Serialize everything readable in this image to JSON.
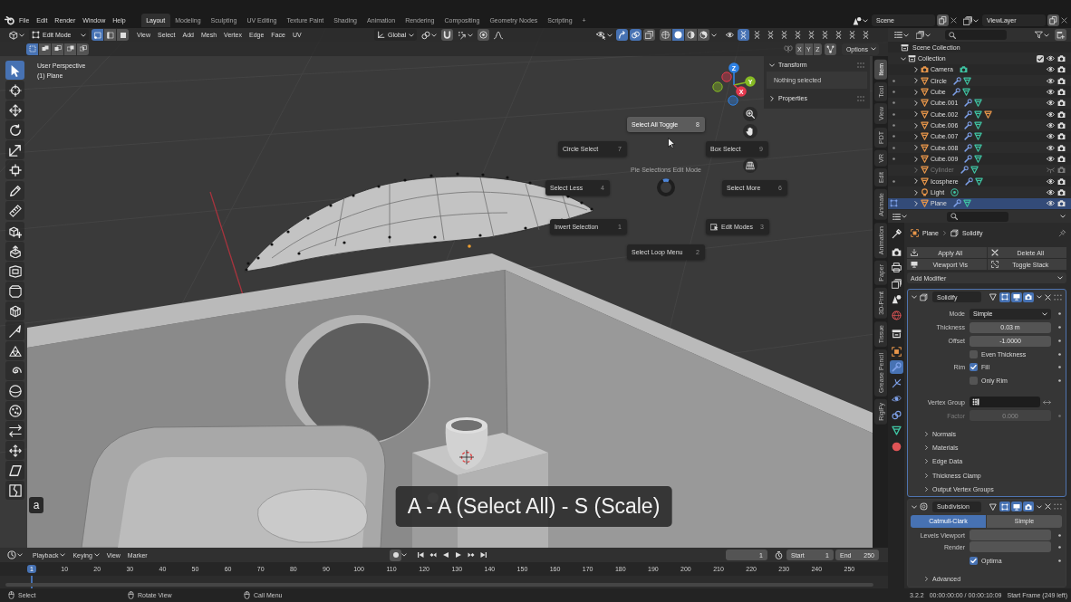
{
  "topbar": {
    "menus": [
      "File",
      "Edit",
      "Render",
      "Window",
      "Help"
    ],
    "workspaces": [
      {
        "label": "Layout",
        "selected": true
      },
      {
        "label": "Modeling",
        "selected": false
      },
      {
        "label": "Sculpting",
        "selected": false
      },
      {
        "label": "UV Editing",
        "selected": false
      },
      {
        "label": "Texture Paint",
        "selected": false
      },
      {
        "label": "Shading",
        "selected": false
      },
      {
        "label": "Animation",
        "selected": false
      },
      {
        "label": "Rendering",
        "selected": false
      },
      {
        "label": "Compositing",
        "selected": false
      },
      {
        "label": "Geometry Nodes",
        "selected": false
      },
      {
        "label": "Scripting",
        "selected": false
      }
    ],
    "add_workspace": "+",
    "scene": "Scene",
    "view_layer": "ViewLayer"
  },
  "viewport": {
    "header": {
      "mode": "Edit Mode",
      "select_modes": [
        {
          "kind": "vertex",
          "selected": true
        },
        {
          "kind": "edge",
          "selected": false
        },
        {
          "kind": "face",
          "selected": false
        }
      ],
      "menus": [
        "View",
        "Select",
        "Add",
        "Mesh",
        "Vertex",
        "Edge",
        "Face",
        "UV"
      ],
      "orientation": "Global",
      "toggles": [
        {
          "kind": "gizmos",
          "on": true
        },
        {
          "kind": "overlays",
          "on": true
        },
        {
          "kind": "xray",
          "on": false
        }
      ],
      "shading": [
        {
          "kind": "wireframe",
          "selected": false
        },
        {
          "kind": "solid",
          "selected": true
        },
        {
          "kind": "material",
          "selected": false
        },
        {
          "kind": "rendered",
          "selected": false
        }
      ],
      "filters": [
        {
          "kind": "eye",
          "selected": false
        },
        {
          "kind": "helix",
          "selected": true
        },
        {
          "kind": "helix",
          "selected": false
        },
        {
          "kind": "helix",
          "selected": false
        },
        {
          "kind": "helix",
          "selected": false
        },
        {
          "kind": "helix",
          "selected": false
        },
        {
          "kind": "helix",
          "selected": false
        },
        {
          "kind": "helix",
          "selected": false
        },
        {
          "kind": "helix",
          "selected": false
        },
        {
          "kind": "helix",
          "selected": false
        },
        {
          "kind": "helix",
          "selected": false
        }
      ]
    },
    "subheader": {
      "box_modes": [
        {
          "kind": "new",
          "selected": true
        },
        {
          "kind": "extend",
          "selected": false
        },
        {
          "kind": "subtract",
          "selected": false
        },
        {
          "kind": "invert",
          "selected": false
        },
        {
          "kind": "intersect",
          "selected": false
        }
      ],
      "mirror_axes": [
        {
          "label": "X",
          "on": false
        },
        {
          "label": "Y",
          "on": false
        },
        {
          "label": "Z",
          "on": false
        }
      ],
      "options": "Options"
    },
    "tool_groups": [
      [
        {
          "kind": "select",
          "selected": true
        },
        {
          "kind": "cursor",
          "selected": false
        },
        {
          "kind": "move",
          "selected": false
        },
        {
          "kind": "rotate",
          "selected": false
        },
        {
          "kind": "scale",
          "selected": false
        },
        {
          "kind": "transform",
          "selected": false
        }
      ],
      [
        {
          "kind": "annotate",
          "selected": false
        },
        {
          "kind": "measure",
          "selected": false
        }
      ],
      [
        {
          "kind": "add_cube",
          "selected": false
        },
        {
          "kind": "extrude",
          "selected": false
        },
        {
          "kind": "inset",
          "selected": false
        },
        {
          "kind": "bevel",
          "selected": false
        },
        {
          "kind": "loop_cut",
          "selected": false
        },
        {
          "kind": "knife",
          "selected": false
        },
        {
          "kind": "poly_build",
          "selected": false
        },
        {
          "kind": "spin",
          "selected": false
        },
        {
          "kind": "smooth",
          "selected": false
        },
        {
          "kind": "randomize",
          "selected": false
        },
        {
          "kind": "edge_slide",
          "selected": false
        },
        {
          "kind": "shrink_fatten",
          "selected": false
        },
        {
          "kind": "shear",
          "selected": false
        },
        {
          "kind": "rip",
          "selected": false
        }
      ]
    ],
    "view_name": "User Perspective",
    "object_label": "(1) Plane",
    "gizmo_axes": [
      {
        "label": "Z",
        "color": "#2f82e4"
      },
      {
        "label": "Y",
        "color": "#86ba24"
      },
      {
        "label": "X",
        "color": "#e5384e"
      }
    ],
    "sidebar": {
      "panels": [
        {
          "title": "Transform",
          "expanded": true,
          "text": "Nothing selected"
        },
        {
          "title": "Properties",
          "expanded": false
        }
      ],
      "tabs": [
        {
          "label": "Item",
          "selected": true
        },
        {
          "label": "Tool",
          "selected": false
        },
        {
          "label": "View",
          "selected": false
        },
        {
          "label": "PDT",
          "selected": false
        },
        {
          "label": "VR",
          "selected": false
        },
        {
          "label": "Edit",
          "selected": false
        },
        {
          "label": "Animate",
          "selected": false
        },
        {
          "label": "Animation",
          "selected": false
        },
        {
          "label": "Paper",
          "selected": false
        },
        {
          "label": "3D-Print",
          "selected": false
        },
        {
          "label": "Tissue",
          "selected": false
        },
        {
          "label": "Grease Pencil",
          "selected": false
        },
        {
          "label": "RigiFy",
          "selected": false
        }
      ]
    },
    "pie_menu": {
      "title": "Pie Selections Edit Mode",
      "items": [
        {
          "label": "Select All Toggle",
          "key": "8",
          "selected": true,
          "with_icon": false
        },
        {
          "label": "Circle Select",
          "key": "7",
          "selected": false,
          "with_icon": false
        },
        {
          "label": "Box Select",
          "key": "9",
          "selected": false,
          "with_icon": false
        },
        {
          "label": "Select Less",
          "key": "4",
          "selected": false,
          "with_icon": false
        },
        {
          "label": "Select More",
          "key": "6",
          "selected": false,
          "with_icon": false
        },
        {
          "label": "Invert Selection",
          "key": "1",
          "selected": false,
          "with_icon": false
        },
        {
          "label": "Edit Modes",
          "key": "3",
          "selected": false,
          "with_icon": true
        },
        {
          "label": "Select Loop Menu",
          "key": "2",
          "selected": false,
          "with_icon": false
        }
      ]
    },
    "key_overlay": "a",
    "caption": "A - A (Select All) - S (Scale)"
  },
  "timeline": {
    "menus": [
      {
        "label": "Playback",
        "dropdown": true
      },
      {
        "label": "Keying",
        "dropdown": true
      },
      {
        "label": "View",
        "dropdown": false
      },
      {
        "label": "Marker",
        "dropdown": false
      }
    ],
    "current_frame": "1",
    "start_label": "Start",
    "start": "1",
    "end_label": "End",
    "end": "250",
    "frames": [
      {
        "label": "1",
        "selected": true
      },
      {
        "label": "10",
        "selected": false
      },
      {
        "label": "20",
        "selected": false
      },
      {
        "label": "30",
        "selected": false
      },
      {
        "label": "40",
        "selected": false
      },
      {
        "label": "50",
        "selected": false
      },
      {
        "label": "60",
        "selected": false
      },
      {
        "label": "70",
        "selected": false
      },
      {
        "label": "80",
        "selected": false
      },
      {
        "label": "90",
        "selected": false
      },
      {
        "label": "100",
        "selected": false
      },
      {
        "label": "110",
        "selected": false
      },
      {
        "label": "120",
        "selected": false
      },
      {
        "label": "130",
        "selected": false
      },
      {
        "label": "140",
        "selected": false
      },
      {
        "label": "150",
        "selected": false
      },
      {
        "label": "160",
        "selected": false
      },
      {
        "label": "170",
        "selected": false
      },
      {
        "label": "180",
        "selected": false
      },
      {
        "label": "190",
        "selected": false
      },
      {
        "label": "200",
        "selected": false
      },
      {
        "label": "210",
        "selected": false
      },
      {
        "label": "220",
        "selected": false
      },
      {
        "label": "230",
        "selected": false
      },
      {
        "label": "240",
        "selected": false
      },
      {
        "label": "250",
        "selected": false
      }
    ]
  },
  "outliner": {
    "root": "Scene Collection",
    "collection": {
      "name": "Collection",
      "expanded": true,
      "checked": true,
      "children": [
        {
          "name": "Camera",
          "kind": "camera",
          "expanded": false,
          "modifiers": false,
          "has_children": false,
          "hidden": false,
          "selected": false
        },
        {
          "name": "Circle",
          "kind": "mesh",
          "expanded": false,
          "modifiers": true,
          "has_children": false,
          "hidden": false,
          "selected": false
        },
        {
          "name": "Cube",
          "kind": "mesh",
          "expanded": false,
          "modifiers": true,
          "has_children": false,
          "hidden": false,
          "selected": false
        },
        {
          "name": "Cube.001",
          "kind": "mesh",
          "expanded": false,
          "modifiers": true,
          "has_children": false,
          "hidden": false,
          "selected": false
        },
        {
          "name": "Cube.002",
          "kind": "mesh",
          "expanded": false,
          "modifiers": true,
          "has_children": true,
          "hidden": false,
          "selected": false
        },
        {
          "name": "Cube.006",
          "kind": "mesh",
          "expanded": false,
          "modifiers": true,
          "has_children": false,
          "hidden": false,
          "selected": false
        },
        {
          "name": "Cube.007",
          "kind": "mesh",
          "expanded": false,
          "modifiers": true,
          "has_children": false,
          "hidden": false,
          "selected": false
        },
        {
          "name": "Cube.008",
          "kind": "mesh",
          "expanded": false,
          "modifiers": true,
          "has_children": false,
          "hidden": false,
          "selected": false
        },
        {
          "name": "Cube.009",
          "kind": "mesh",
          "expanded": false,
          "modifiers": true,
          "has_children": false,
          "hidden": false,
          "selected": false
        },
        {
          "name": "Cylinder",
          "kind": "mesh",
          "expanded": false,
          "modifiers": true,
          "has_children": false,
          "hidden": true,
          "selected": false
        },
        {
          "name": "Icosphere",
          "kind": "mesh",
          "expanded": false,
          "modifiers": true,
          "has_children": false,
          "hidden": false,
          "selected": false
        },
        {
          "name": "Light",
          "kind": "light",
          "expanded": false,
          "modifiers": false,
          "has_children": false,
          "hidden": false,
          "selected": false
        },
        {
          "name": "Plane",
          "kind": "mesh",
          "expanded": false,
          "modifiers": true,
          "has_children": false,
          "hidden": false,
          "selected": true
        }
      ]
    }
  },
  "properties": {
    "tab_groups": [
      [
        {
          "kind": "tool",
          "selected": false
        }
      ],
      [
        {
          "kind": "render",
          "selected": false
        },
        {
          "kind": "output",
          "selected": false
        },
        {
          "kind": "view_layer",
          "selected": false
        },
        {
          "kind": "scene",
          "selected": false
        },
        {
          "kind": "world",
          "selected": false
        }
      ],
      [
        {
          "kind": "collection",
          "selected": false
        }
      ],
      [
        {
          "kind": "object",
          "selected": false
        },
        {
          "kind": "modifiers",
          "selected": true
        },
        {
          "kind": "particles",
          "selected": false
        },
        {
          "kind": "physics",
          "selected": false
        },
        {
          "kind": "constraints",
          "selected": false
        },
        {
          "kind": "data",
          "selected": false
        },
        {
          "kind": "material",
          "selected": false
        }
      ]
    ],
    "breadcrumb": [
      "Plane",
      "Solidify"
    ],
    "actions": [
      {
        "label": "Apply All",
        "kind": "apply"
      },
      {
        "label": "Delete All",
        "kind": "delete"
      },
      {
        "label": "Viewport Vis",
        "kind": "viewport"
      },
      {
        "label": "Toggle Stack",
        "kind": "stack"
      }
    ],
    "add_modifier": "Add Modifier",
    "modifiers": [
      {
        "name": "Solidify",
        "kind": "solidify",
        "active": true,
        "expanded": true,
        "toggles": [
          {
            "kind": "cage",
            "on": false
          },
          {
            "kind": "edit",
            "on": true
          },
          {
            "kind": "viewport",
            "on": true
          },
          {
            "kind": "render",
            "on": true
          }
        ],
        "rows": [
          {
            "kind": "dropdown",
            "label": "Mode",
            "value": "Simple",
            "disabled": false
          },
          {
            "kind": "number",
            "label": "Thickness",
            "value": "0.03 m",
            "disabled": false
          },
          {
            "kind": "number",
            "label": "Offset",
            "value": "-1.0000",
            "disabled": false
          },
          {
            "kind": "checkbox",
            "text": "Even Thickness",
            "checked": false,
            "disabled": false
          },
          {
            "kind": "checkbox",
            "label": "Rim",
            "text": "Fill",
            "checked": true,
            "disabled": false
          },
          {
            "kind": "checkbox",
            "text": "Only Rim",
            "checked": false,
            "disabled": false
          },
          {
            "kind": "vertex_group",
            "label": "Vertex Group",
            "disabled": false
          },
          {
            "kind": "number",
            "label": "Factor",
            "value": "0.000",
            "disabled": true
          }
        ],
        "subpanels": [
          {
            "title": "Normals",
            "expanded": false
          },
          {
            "title": "Materials",
            "expanded": false
          },
          {
            "title": "Edge Data",
            "expanded": false
          },
          {
            "title": "Thickness Clamp",
            "expanded": false
          },
          {
            "title": "Output Vertex Groups",
            "expanded": false
          }
        ]
      },
      {
        "name": "Subdivision",
        "kind": "subdivision",
        "active": false,
        "expanded": true,
        "toggles": [
          {
            "kind": "cage",
            "on": false
          },
          {
            "kind": "edit",
            "on": true
          },
          {
            "kind": "viewport",
            "on": true
          },
          {
            "kind": "render",
            "on": true
          }
        ],
        "rows": [
          {
            "kind": "segmented",
            "disabled": false,
            "options": [
              {
                "label": "Catmull-Clark",
                "selected": true
              },
              {
                "label": "Simple",
                "selected": false
              }
            ]
          },
          {
            "kind": "number",
            "label": "Levels Viewport",
            "disabled": false
          },
          {
            "kind": "number",
            "label": "Render",
            "disabled": false
          },
          {
            "kind": "checkbox",
            "text": "Optima",
            "checked": true,
            "disabled": false
          }
        ],
        "subpanels": [
          {
            "title": "Advanced",
            "expanded": false
          }
        ]
      }
    ]
  },
  "status_bar": {
    "hints": [
      "Select",
      "Rotate View",
      "Call Menu"
    ],
    "version": "3.2.2",
    "time": "00:00:00:00 / 00:00:10:09",
    "frame_info": "Start Frame (249 left)"
  }
}
